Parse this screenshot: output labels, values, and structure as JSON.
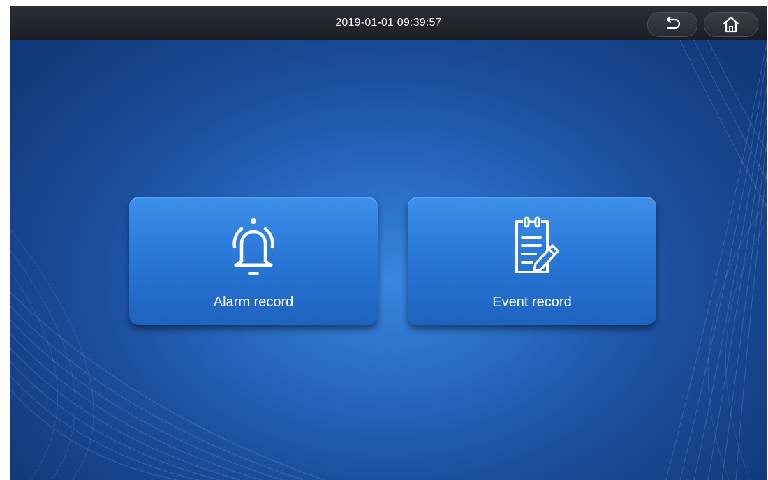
{
  "statusbar": {
    "datetime": "2019-01-01 09:39:57",
    "back_icon": "back-arrow-icon",
    "home_icon": "home-icon"
  },
  "tiles": [
    {
      "label": "Alarm record",
      "icon": "bell-icon"
    },
    {
      "label": "Event record",
      "icon": "notepad-icon"
    }
  ],
  "colors": {
    "background": "#1c4f9e",
    "tile": "#2a78d8",
    "topbar": "#23262c",
    "text": "#ffffff"
  }
}
